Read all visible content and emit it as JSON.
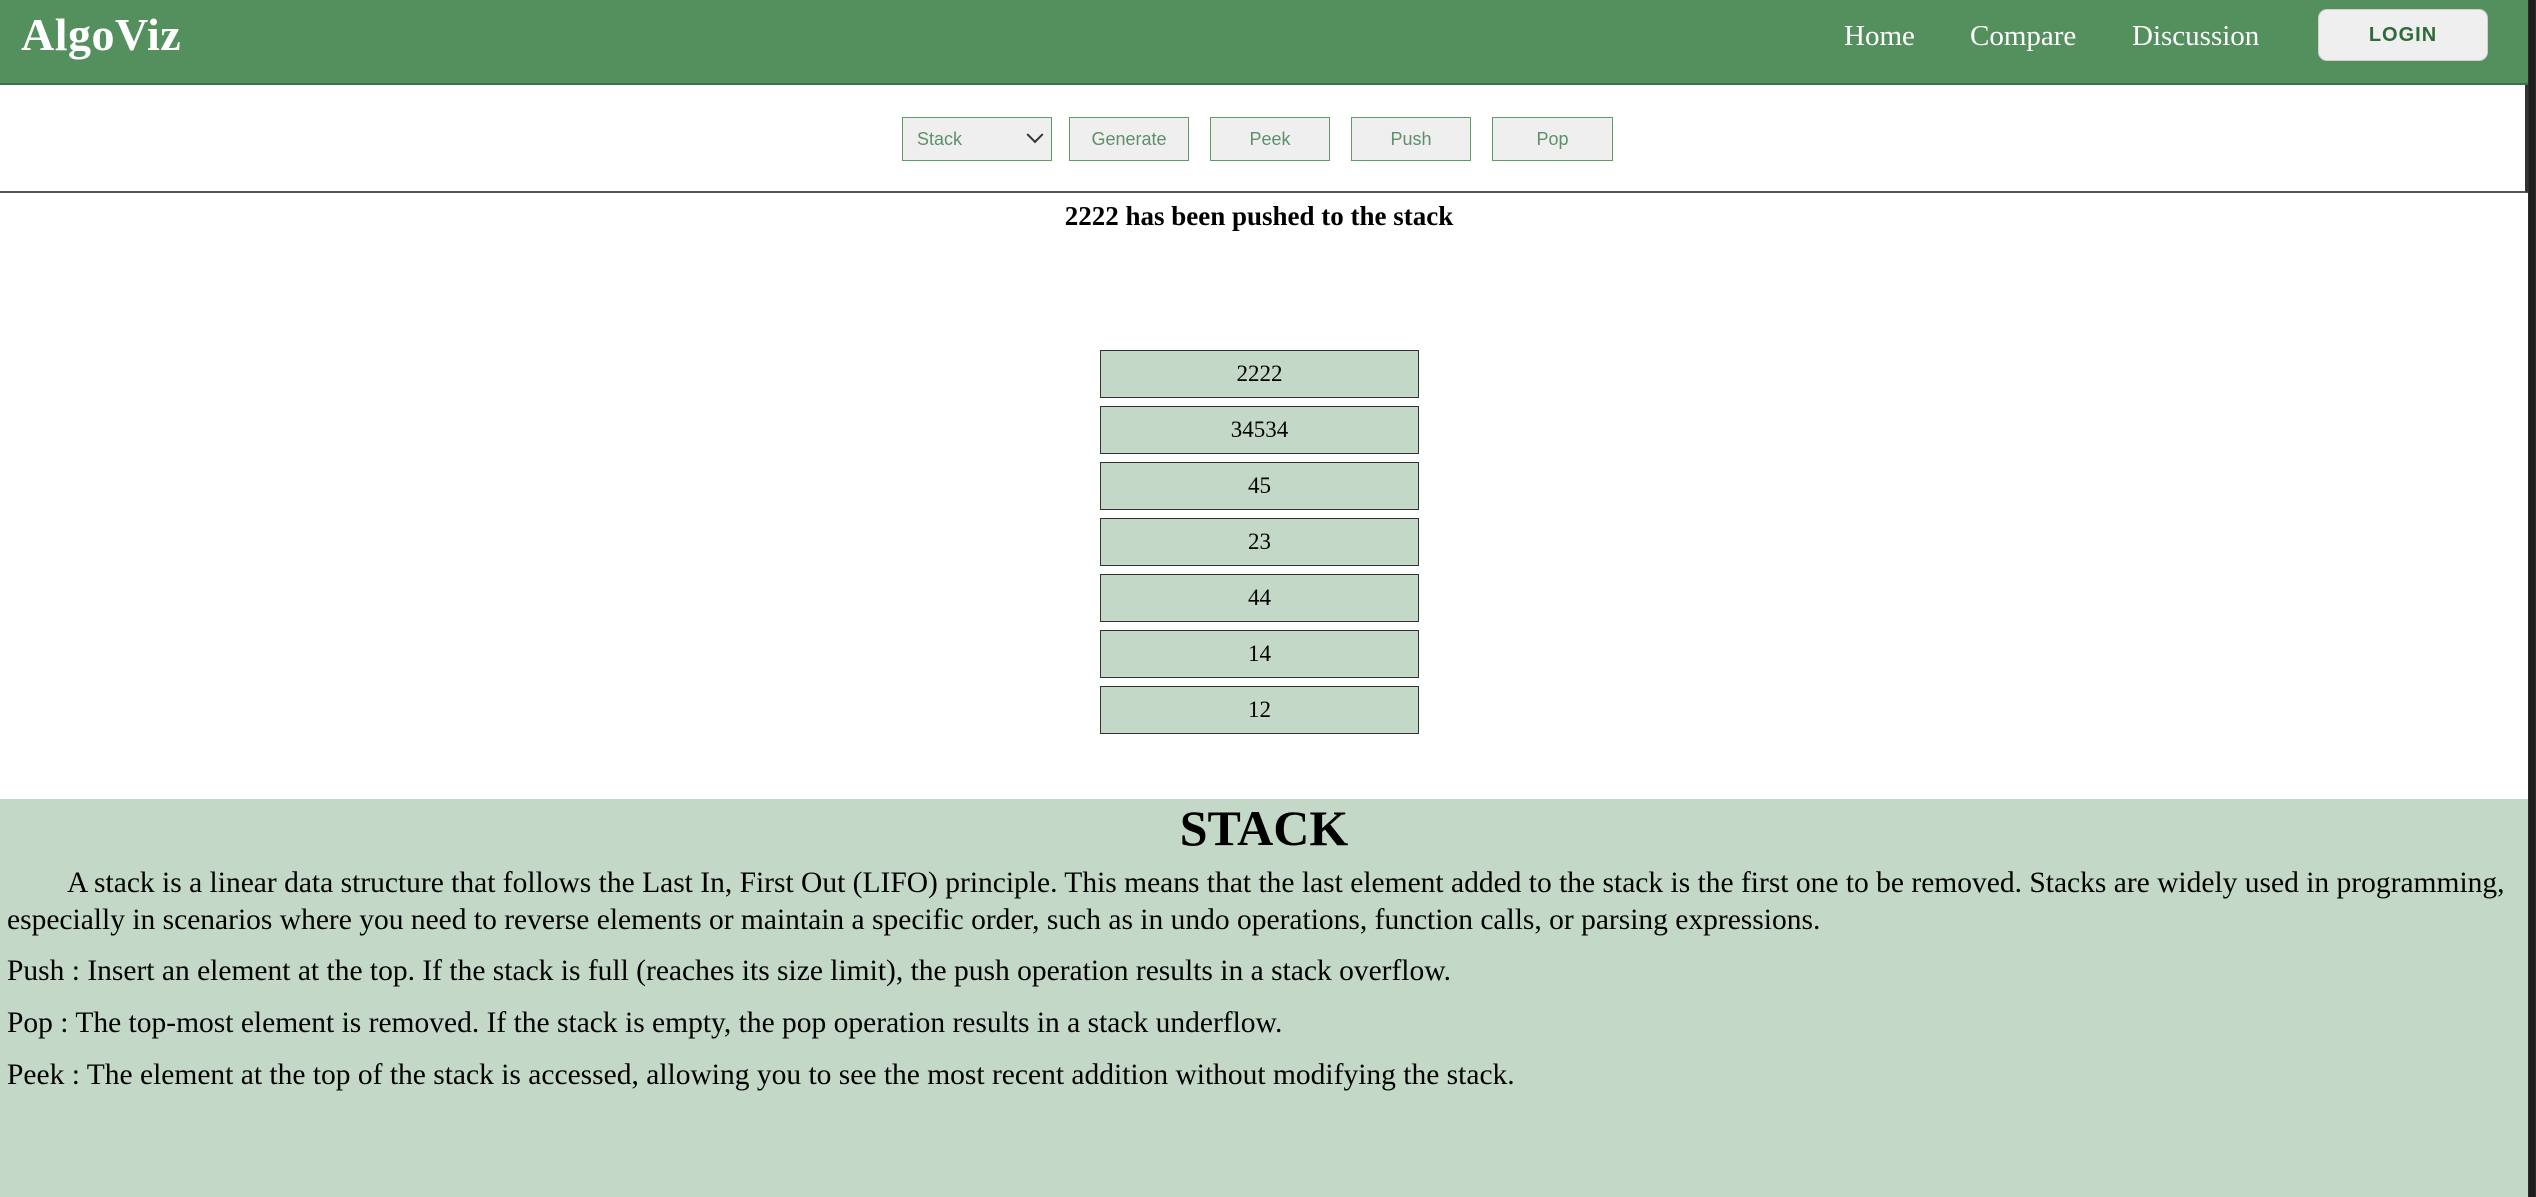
{
  "header": {
    "brand": "AlgoViz",
    "nav": [
      "Home",
      "Compare",
      "Discussion"
    ],
    "login_label": "LOGIN"
  },
  "controls": {
    "select_value": "Stack",
    "generate_label": "Generate",
    "peek_label": "Peek",
    "push_label": "Push",
    "pop_label": "Pop"
  },
  "message": "2222 has been pushed to the stack",
  "stack": {
    "items": [
      "2222",
      "34534",
      "45",
      "23",
      "44",
      "14",
      "12"
    ]
  },
  "info": {
    "title": "STACK",
    "intro": "A stack is a linear data structure that follows the Last In, First Out (LIFO) principle. This means that the last element added to the stack is the first one to be removed. Stacks are widely used in programming, especially in scenarios where you need to reverse elements or maintain a specific order, such as in undo operations, function calls, or parsing expressions.",
    "push": "Push : Insert an element at the top. If the stack is full (reaches its size limit), the push operation results in a stack overflow.",
    "pop": "Pop : The top-most element is removed. If the stack is empty, the pop operation results in a stack underflow.",
    "peek": "Peek : The element at the top of the stack is accessed, allowing you to see the most recent addition without modifying the stack."
  },
  "colors": {
    "header_green": "#548f5e",
    "panel_green": "#c3d8c7",
    "button_bg": "#efefef",
    "button_border": "#5f9a69"
  }
}
